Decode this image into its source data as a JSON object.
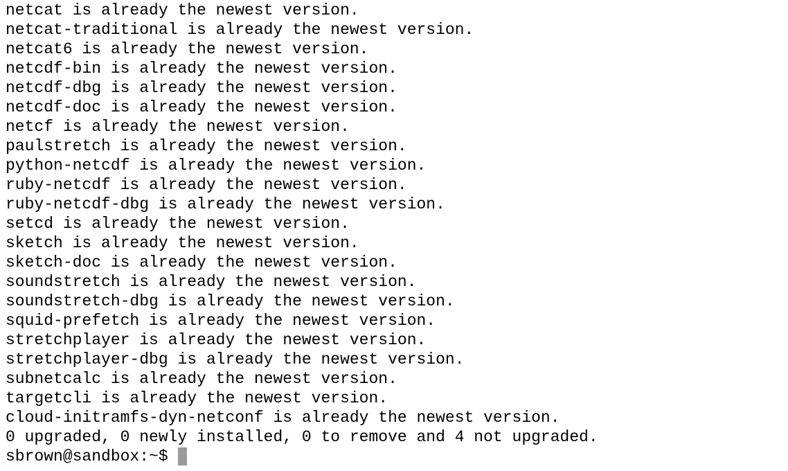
{
  "terminal": {
    "lines": [
      "netcat is already the newest version.",
      "netcat-traditional is already the newest version.",
      "netcat6 is already the newest version.",
      "netcdf-bin is already the newest version.",
      "netcdf-dbg is already the newest version.",
      "netcdf-doc is already the newest version.",
      "netcf is already the newest version.",
      "paulstretch is already the newest version.",
      "python-netcdf is already the newest version.",
      "ruby-netcdf is already the newest version.",
      "ruby-netcdf-dbg is already the newest version.",
      "setcd is already the newest version.",
      "sketch is already the newest version.",
      "sketch-doc is already the newest version.",
      "soundstretch is already the newest version.",
      "soundstretch-dbg is already the newest version.",
      "squid-prefetch is already the newest version.",
      "stretchplayer is already the newest version.",
      "stretchplayer-dbg is already the newest version.",
      "subnetcalc is already the newest version.",
      "targetcli is already the newest version.",
      "cloud-initramfs-dyn-netconf is already the newest version.",
      "0 upgraded, 0 newly installed, 0 to remove and 4 not upgraded."
    ],
    "prompt": "sbrown@sandbox:~$",
    "colors": {
      "background": "#ffffff",
      "text": "#000000",
      "cursor": "#9a9a9a"
    }
  }
}
